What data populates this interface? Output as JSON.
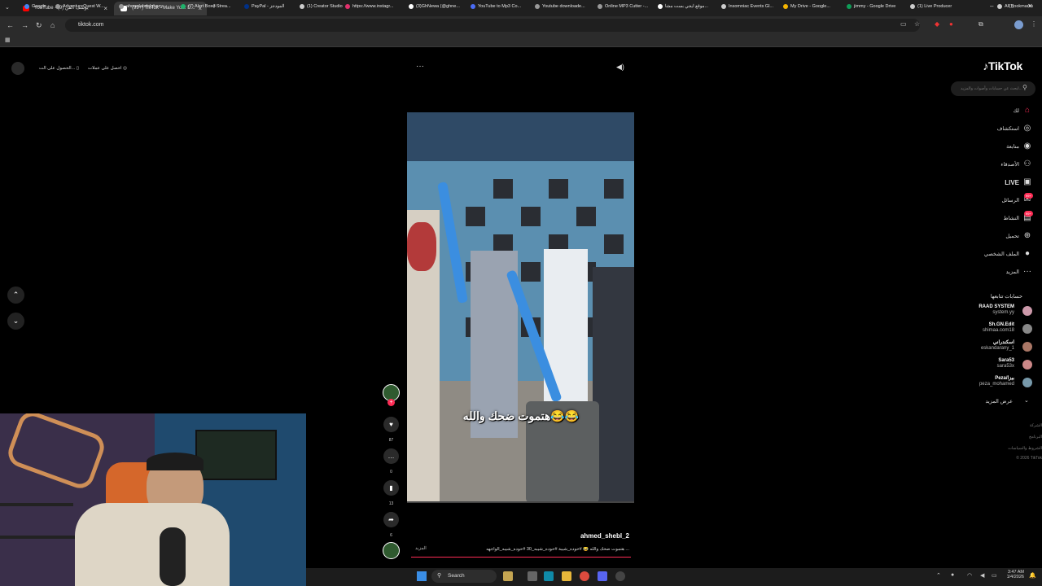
{
  "browser": {
    "tabs": [
      {
        "title": "YouTube - يوسف الفن (9)",
        "icon_color": "#ff0000",
        "active": false
      },
      {
        "title": "(99+) TikTok - Make Your D...",
        "icon_color": "#ffffff",
        "active": true
      }
    ],
    "new_tab": "+",
    "url": "tiktok.com",
    "bookmarks": [
      {
        "label": "Google",
        "color": "#4285f4"
      },
      {
        "label": "AdventureQuest W...",
        "color": "#999999"
      },
      {
        "label": "ahmedabdelghany...",
        "color": "#999999"
      },
      {
        "label": "(7) Alert Box / Strea...",
        "color": "#1fb26b"
      },
      {
        "label": "PayPal - المودجز",
        "color": "#003087"
      },
      {
        "label": "(1) Creator Studio",
        "color": "#cccccc"
      },
      {
        "label": "https://www.instagr...",
        "color": "#e1306c"
      },
      {
        "label": "(3)GhNewa (@ghne...",
        "color": "#ffffff"
      },
      {
        "label": "YouTube to Mp3 Co...",
        "color": "#4a6cf7"
      },
      {
        "label": "Youtube downloade...",
        "color": "#999999"
      },
      {
        "label": "Online MP3 Cutter -...",
        "color": "#999999"
      },
      {
        "label": "موقع ايجي بست مشا...",
        "color": "#ffffff"
      },
      {
        "label": "Insomniac Events Gl...",
        "color": "#cccccc"
      },
      {
        "label": "My Drive - Google...",
        "color": "#f4b400"
      },
      {
        "label": "jimmy - Google Drive",
        "color": "#0f9d58"
      },
      {
        "label": "(1) Live Producer",
        "color": "#cccccc"
      },
      {
        "label": "All Bookmarks",
        "color": "#cccccc"
      }
    ]
  },
  "tiktok": {
    "logo": "TikTok",
    "search_placeholder": "ابحث عن حسابات وأصوات والمزيد...",
    "top_left": {
      "get_coins": "احصل على عملات",
      "get_app": "الحصول على الت..."
    },
    "nav": [
      {
        "label": "لك",
        "icon": "home-icon",
        "active": true
      },
      {
        "label": "استكشاف",
        "icon": "compass-icon"
      },
      {
        "label": "متابعة",
        "icon": "following-icon"
      },
      {
        "label": "الأصدقاء",
        "icon": "friends-icon"
      },
      {
        "label": "LIVE",
        "icon": "live-icon"
      },
      {
        "label": "الرسائل",
        "icon": "messages-icon",
        "badge": "99+"
      },
      {
        "label": "النشاط",
        "icon": "activity-icon",
        "badge": "99+"
      },
      {
        "label": "تحميل",
        "icon": "upload-icon"
      },
      {
        "label": "الملف الشخصي",
        "icon": "profile-icon"
      },
      {
        "label": "المزيد",
        "icon": "more-icon"
      }
    ],
    "following_title": "حسابات تتابعها",
    "following": [
      {
        "name": "RAAD SYSTEM",
        "handle": "system.yy",
        "color": "#c9a"
      },
      {
        "name": "Sh.GN.Edit",
        "handle": "shimaa.com18",
        "color": "#888"
      },
      {
        "name": "اسكندراني",
        "handle": "eskandarany_1",
        "color": "#a76"
      },
      {
        "name": "Sara53",
        "handle": "sara53x",
        "color": "#c88"
      },
      {
        "name": "Peza/بيزا",
        "handle": "peza_mohamed",
        "color": "#79a"
      }
    ],
    "see_more": "عرض المزيد",
    "footer": [
      "الشركة",
      "البرنامج",
      "الشروط والسياسات",
      "© 2026 TikTok"
    ],
    "video": {
      "overlay_text": "هتموت ضحك والله😂😂",
      "author": "ahmed_shebl_2",
      "description": "هتموت ضحك والله 😂 #حوده_شيبة #حوده_شيبه_30 #حوده_شيبه_الواجهه ...",
      "more": "المزيد",
      "likes": "87",
      "comments": "0",
      "saves": "13",
      "shares": "6"
    }
  },
  "taskbar": {
    "search": "Search",
    "time": "3:47 AM",
    "date": "1/4/2026"
  }
}
